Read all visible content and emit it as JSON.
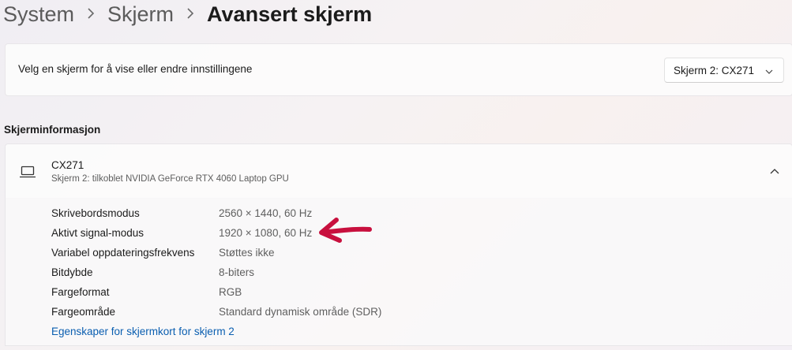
{
  "breadcrumb": {
    "items": [
      "System",
      "Skjerm"
    ],
    "current": "Avansert skjerm"
  },
  "display_select": {
    "label": "Velg en skjerm for å vise eller endre innstillingene",
    "value": "Skjerm 2: CX271"
  },
  "section": {
    "title": "Skjerminformasjon"
  },
  "monitor": {
    "name": "CX271",
    "subtitle": "Skjerm 2: tilkoblet NVIDIA GeForce RTX 4060 Laptop GPU",
    "expanded": true
  },
  "details": [
    {
      "key": "Skrivebordsmodus",
      "value": "2560 × 1440, 60 Hz"
    },
    {
      "key": "Aktivt signal-modus",
      "value": "1920 × 1080, 60 Hz"
    },
    {
      "key": "Variabel oppdateringsfrekvens",
      "value": "Støttes ikke"
    },
    {
      "key": "Bitdybde",
      "value": "8-biters"
    },
    {
      "key": "Fargeformat",
      "value": "RGB"
    },
    {
      "key": "Fargeområde",
      "value": "Standard dynamisk område (SDR)"
    }
  ],
  "adapter_link": "Egenskaper for skjermkort for skjerm 2",
  "icons": {
    "separator": "chevron-right-icon",
    "dropdown": "chevron-down-icon",
    "monitor": "laptop-icon",
    "collapse": "chevron-up-icon",
    "annotation": "red-arrow-annotation"
  },
  "colors": {
    "link": "#0a5eb0",
    "annotation": "#c8103e"
  }
}
